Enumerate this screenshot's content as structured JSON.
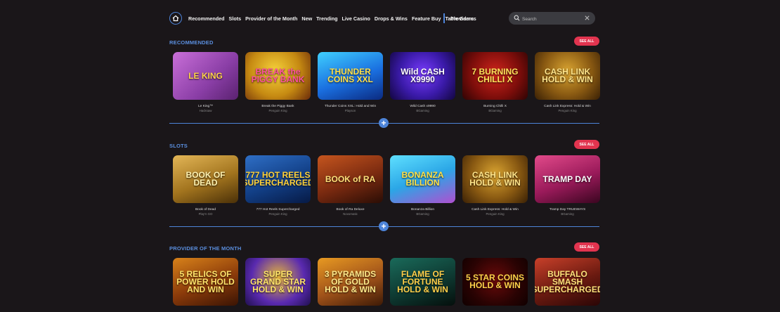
{
  "nav": {
    "links": [
      "Recommended",
      "Slots",
      "Provider of the Month",
      "New",
      "Trending",
      "Live Casino",
      "Drops & Wins",
      "Feature Buy",
      "Table Games"
    ],
    "providers": "Providers",
    "search_placeholder": "Search"
  },
  "colors": {
    "accent": "#4d84d9",
    "see_all": "#e2344f",
    "background": "#1a1619"
  },
  "sections": [
    {
      "title": "RECOMMENDED",
      "see_all": "SEE ALL",
      "games": [
        {
          "art": "LE KING",
          "name": "Le King™",
          "provider": "Hacksaw"
        },
        {
          "art": "BREAK the PIGGY BANK",
          "name": "Break the Piggy Bank",
          "provider": "Penguin King"
        },
        {
          "art": "THUNDER COINS XXL",
          "name": "Thunder Coins XXL: Hold and Win",
          "provider": "Playson"
        },
        {
          "art": "Wild CASH X9990",
          "name": "Wild Cash x9990",
          "provider": "BGaming"
        },
        {
          "art": "7 BURNING CHILLI X",
          "name": "Burning Chilli X",
          "provider": "BGaming"
        },
        {
          "art": "CASH LINK HOLD & WIN",
          "name": "Cash Link Express: Hold & Win",
          "provider": "Penguin King"
        }
      ]
    },
    {
      "title": "SLOTS",
      "see_all": "SEE ALL",
      "games": [
        {
          "art": "BOOK OF DEAD",
          "name": "Book of Dead",
          "provider": "Play'n GO"
        },
        {
          "art": "777 HOT REELS SUPERCHARGED",
          "name": "777 Hot Reels Supercharged",
          "provider": "Penguin King"
        },
        {
          "art": "BOOK of RA",
          "name": "Book of Ra Deluxe",
          "provider": "Novomatic"
        },
        {
          "art": "BONANZA BILLION",
          "name": "Bonanza Billion",
          "provider": "BGaming"
        },
        {
          "art": "CASH LINK HOLD & WIN",
          "name": "Cash Link Express: Hold & Win",
          "provider": "Penguin King"
        },
        {
          "art": "TRAMP DAY",
          "name": "Tramp Day TRUEWAYS",
          "provider": "BGaming"
        }
      ]
    },
    {
      "title": "PROVIDER OF THE MONTH",
      "see_all": "SEE ALL",
      "games": [
        {
          "art": "5 RELICS OF POWER HOLD AND WIN"
        },
        {
          "art": "SUPER GRAND STAR HOLD & WIN"
        },
        {
          "art": "3 PYRAMIDS OF GOLD HOLD & WIN"
        },
        {
          "art": "FLAME OF FORTUNE HOLD & WIN"
        },
        {
          "art": "5 STAR COINS HOLD & WIN"
        },
        {
          "art": "BUFFALO SMASH SUPERCHARGED"
        }
      ]
    }
  ]
}
